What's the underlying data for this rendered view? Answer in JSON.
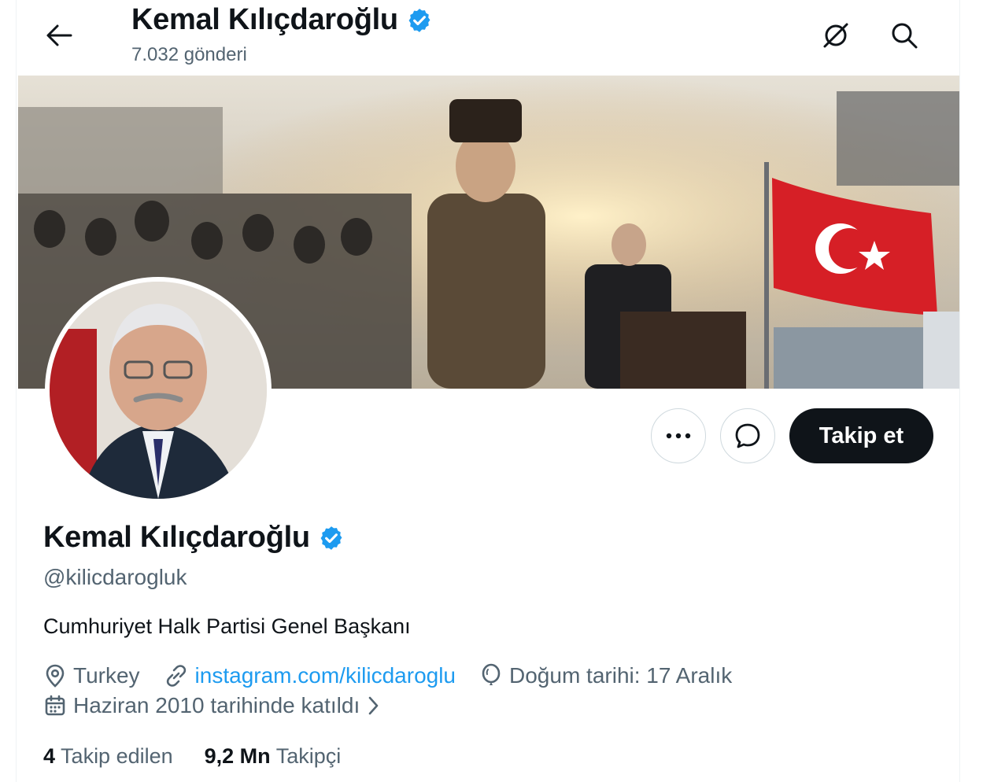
{
  "header": {
    "title": "Kemal Kılıçdaroğlu",
    "post_count": "7.032 gönderi",
    "back_icon": "arrow-left-icon",
    "grok_icon": "grok-icon",
    "search_icon": "search-icon"
  },
  "banner": {
    "description_icon": "banner-image"
  },
  "profile": {
    "display_name": "Kemal Kılıçdaroğlu",
    "handle": "@kilicdarogluk",
    "bio": "Cumhuriyet Halk Partisi Genel Başkanı",
    "location": "Turkey",
    "website": "instagram.com/kilicdaroglu",
    "birthday": "Doğum tarihi: 17 Aralık",
    "joined": "Haziran 2010 tarihinde katıldı",
    "following_count": "4",
    "following_label": "Takip edilen",
    "followers_count": "9,2 Mn",
    "followers_label": "Takipçi"
  },
  "actions": {
    "more_icon": "more-icon",
    "message_icon": "message-icon",
    "follow_label": "Takip et"
  },
  "colors": {
    "verified": "#1d9bf0",
    "link": "#1d9bf0",
    "muted": "#536471",
    "text": "#0f1419"
  }
}
